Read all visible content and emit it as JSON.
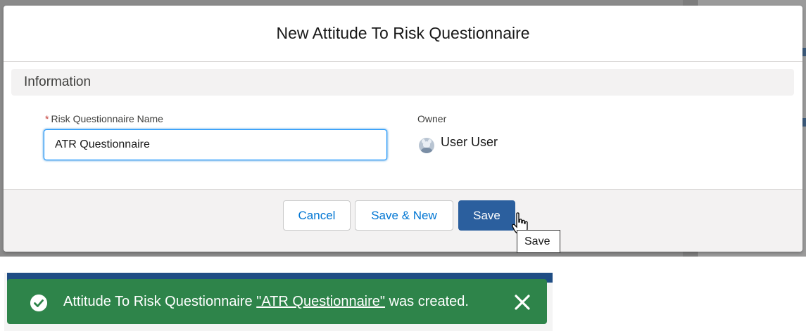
{
  "modal": {
    "title": "New Attitude To Risk Questionnaire",
    "section_title": "Information",
    "name_field": {
      "required_marker": "*",
      "label": "Risk Questionnaire Name",
      "value": "ATR Questionnaire"
    },
    "owner": {
      "label": "Owner",
      "name": "User User",
      "avatar_icon": "avatar-icon"
    },
    "buttons": {
      "cancel": "Cancel",
      "save_new": "Save & New",
      "save": "Save"
    },
    "tooltip": "Save"
  },
  "toast": {
    "message_prefix": "Attitude To Risk Questionnaire ",
    "link_text": "\"ATR Questionnaire\"",
    "message_suffix": " was created.",
    "icon": "check-circle-icon",
    "close_icon": "close-icon",
    "color": "#2e844a"
  },
  "colors": {
    "brand": "#2b5f9e",
    "link": "#0176d3",
    "success": "#2e844a",
    "required": "#c23934"
  }
}
